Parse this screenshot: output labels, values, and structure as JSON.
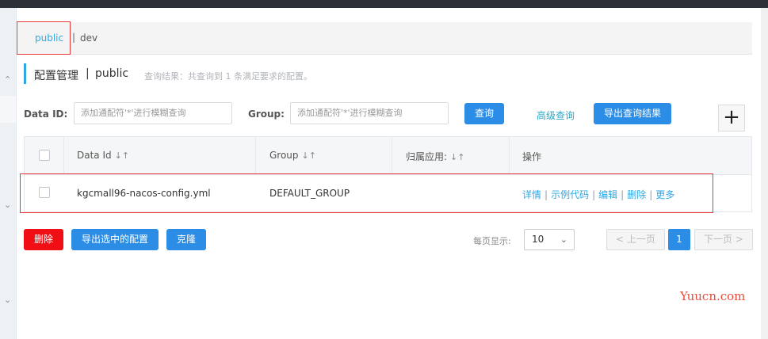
{
  "tabs": {
    "active": "public",
    "separator": "|",
    "other": "dev"
  },
  "header": {
    "title": "配置管理",
    "separator": "|",
    "namespace": "public",
    "result_text": "查询结果：共查询到 1 条满足要求的配置。"
  },
  "search": {
    "dataid_label": "Data ID:",
    "dataid_placeholder": "添加通配符'*'进行模糊查询",
    "group_label": "Group:",
    "group_placeholder": "添加通配符'*'进行模糊查询",
    "query_button": "查询",
    "advanced_link": "高级查询",
    "export_results_button": "导出查询结果",
    "add_glyph": "+"
  },
  "table": {
    "columns": [
      "Data Id",
      "Group",
      "归属应用:",
      "操作"
    ],
    "sort_glyph": "↓↑",
    "rows": [
      {
        "data_id": "kgcmall96-nacos-config.yml",
        "group": "DEFAULT_GROUP",
        "app": "",
        "actions": [
          "详情",
          "示例代码",
          "编辑",
          "删除",
          "更多"
        ]
      }
    ],
    "action_separator": "|"
  },
  "bulk": {
    "delete_button": "删除",
    "export_selected_button": "导出选中的配置",
    "clone_button": "克隆"
  },
  "pagination": {
    "per_page_label": "每页显示:",
    "per_page_value": "10",
    "prev": "上一页",
    "current_page": "1",
    "next": "下一页"
  },
  "watermark": "Yuucn.com",
  "colors": {
    "accent": "#2ea8e5",
    "primary_button": "#2c8de6",
    "danger": "#f00f14",
    "highlight_box": "#e6383b"
  }
}
